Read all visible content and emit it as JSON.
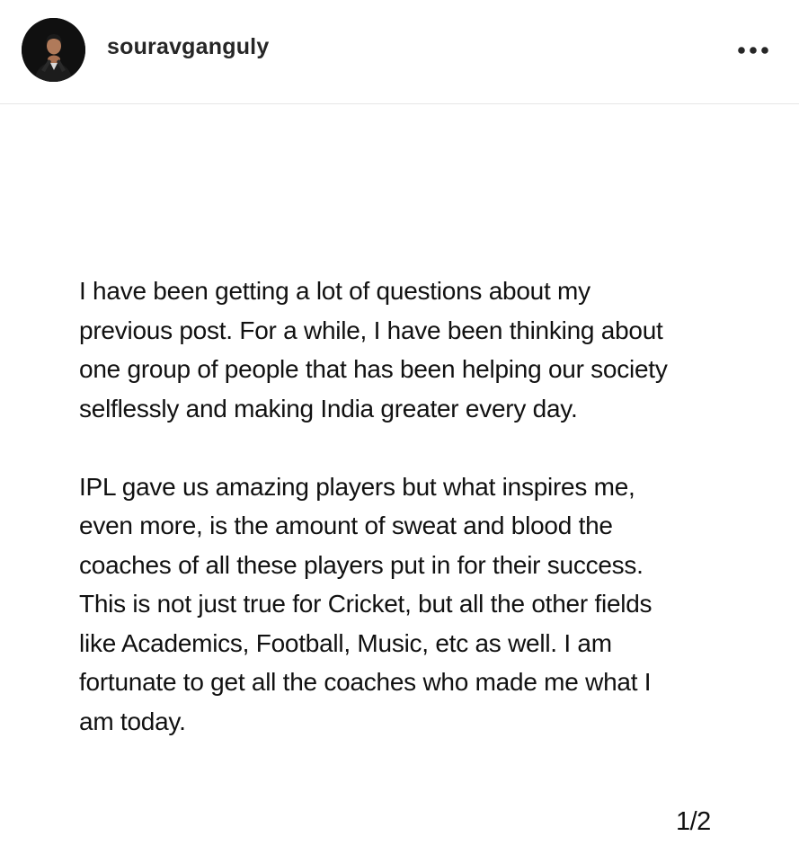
{
  "header": {
    "username": "souravganguly",
    "avatar_icon": "profile-photo-icon",
    "more_icon": "more-horizontal-icon"
  },
  "post": {
    "lines_p1": [
      "I have been getting a lot of questions about my",
      "previous post. For a while, I have been thinking about",
      "one group of people that has been helping our society",
      "selflessly and making India greater every day."
    ],
    "lines_p2": [
      "IPL gave us amazing players but what inspires me,",
      "even more, is the amount of sweat and blood the",
      "coaches of all these players put in for their success.",
      "This is not just true for Cricket, but all the other fields",
      "like Academics, Football, Music, etc as well. I am",
      "fortunate to get all the coaches who made me what I",
      "am today."
    ]
  },
  "page_indicator": "1/2"
}
